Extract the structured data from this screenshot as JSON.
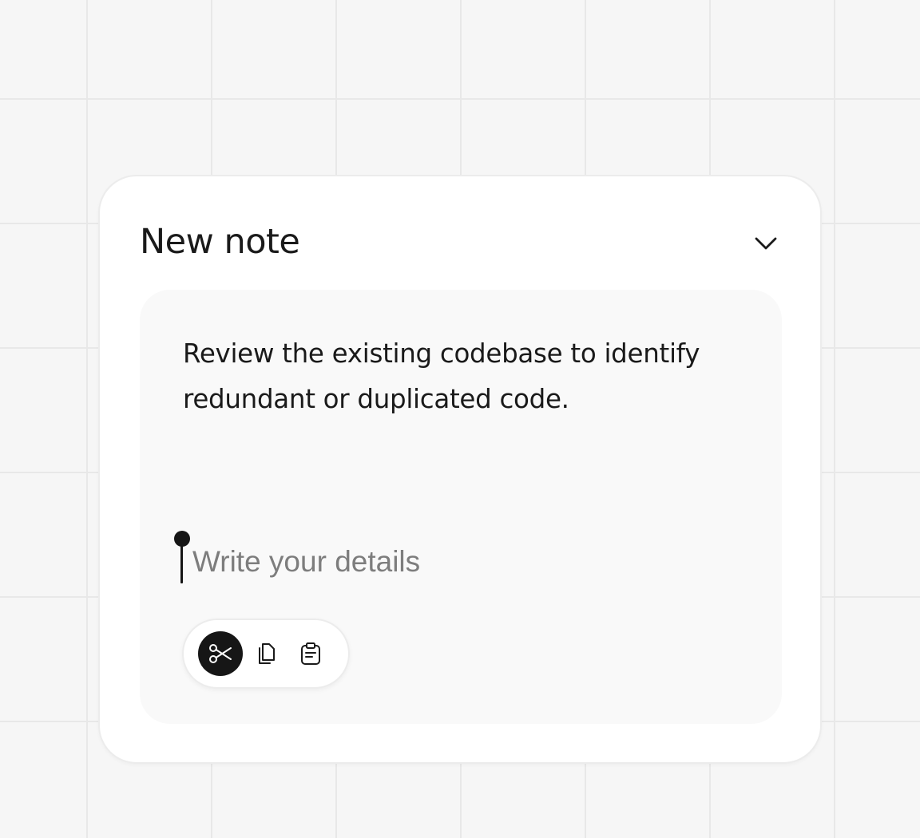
{
  "note": {
    "title": "New note",
    "body": "Review the existing codebase to identify redundant or duplicated code.",
    "details_placeholder": "Write your details",
    "details_value": ""
  },
  "icons": {
    "collapse": "chevron-down-icon",
    "cut": "scissors-icon",
    "copy": "copy-icon",
    "paste": "clipboard-icon"
  },
  "toolbar": {
    "active_tool": "cut"
  },
  "colors": {
    "background": "#f6f6f6",
    "grid_line": "#e8e8e8",
    "card": "#ffffff",
    "editor": "#f9f9f9",
    "text": "#1a1a1a",
    "placeholder": "#7d7d7d",
    "active_tool_bg": "#161616"
  }
}
